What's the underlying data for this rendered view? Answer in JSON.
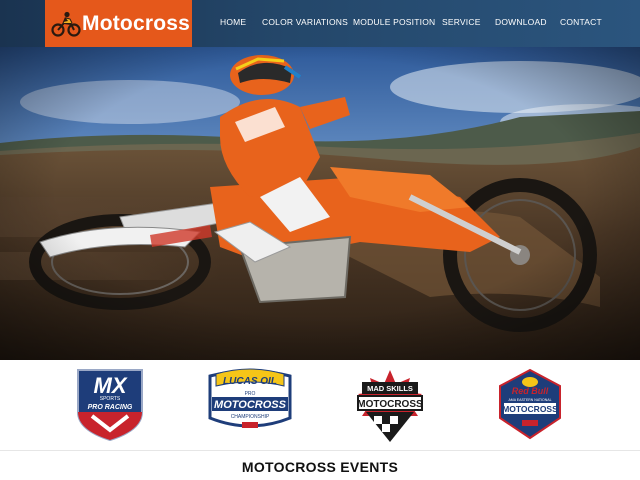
{
  "brand": {
    "name": "Motocross",
    "accent": "#e5581b",
    "header_bg": "#24476a"
  },
  "nav": {
    "items": [
      {
        "label": "HOME"
      },
      {
        "label": "COLOR VARIATIONS"
      },
      {
        "label": "MODULE POSITION"
      },
      {
        "label": "SERVICE"
      },
      {
        "label": "DOWNLOAD"
      },
      {
        "label": "CONTACT"
      }
    ]
  },
  "hero": {
    "icon": "motocross-rider-photo"
  },
  "sponsors": {
    "mx": {
      "line1": "MX",
      "line2": "SPORTS",
      "line3": "PRO RACING"
    },
    "lucas": {
      "line1": "LUCAS OIL",
      "line2": "PRO",
      "line3": "MOTOCROSS",
      "line4": "CHAMPIONSHIP"
    },
    "madskills": {
      "line1": "MAD SKILLS",
      "line2": "MOTOCROSS"
    },
    "redbull": {
      "line1": "Red Bull",
      "line2": "AMA EASTERN NATIONAL",
      "line3": "MOTOCROSS"
    }
  },
  "events": {
    "title": "MOTOCROSS EVENTS"
  }
}
